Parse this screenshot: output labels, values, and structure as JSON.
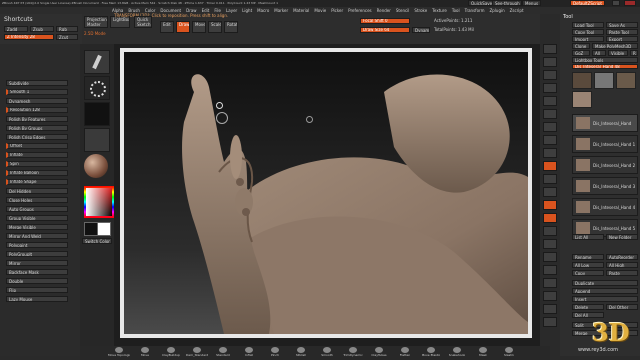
{
  "title_bar": {
    "text": "ZBrush 4R7 P3 (x64)(2-0 Single User License) ZBrush Document · Free Mem 13.8GB · Active Mem 542 · Scratch Disk 48 · ZTime 1.637 · Timer 0.011 · PolyCount 1.43 MP · MeshCount 1",
    "quicksave": "QuickSave",
    "see_through_label": "See-through",
    "see_through_value": "0",
    "menus_label": "Menus",
    "default_zscript": "DefaultZScript"
  },
  "menu_bar": [
    "Alpha",
    "Brush",
    "Color",
    "Document",
    "Draw",
    "Edit",
    "File",
    "Layer",
    "Light",
    "Macro",
    "Marker",
    "Material",
    "Movie",
    "Picker",
    "Preferences",
    "Render",
    "Stencil",
    "Stroke",
    "Texture",
    "Tool",
    "Transform",
    "Zplugin",
    "Zscript"
  ],
  "top_left": {
    "shortcuts_label": "Shortcuts",
    "zadd": "Zadd",
    "zsub": "Zsub",
    "zcut": "Zcut",
    "z_intensity": "Z Intensity 28",
    "rgb": "Rgb"
  },
  "toolbar": {
    "edit_label": "Edit",
    "draw_label": "Draw",
    "move_label": "Move",
    "scale_label": "Scale",
    "rotate_label": "Rotate",
    "focal_shift": "Focal Shift 0",
    "draw_size": "Draw Size 64",
    "active_points": "ActivePoints: 1.211",
    "total_points": "TotalPoints: 1.43 Mil",
    "dynamic": "Dynamic",
    "lightbox": "LightBox",
    "projection_master": "Projection Master",
    "quick_sketch": "Quick Sketch"
  },
  "notice": {
    "title": "2.5D Mode",
    "hint": "TRANSFORM [2D]: Click to reposition. Press shift to align."
  },
  "left_panel": {
    "items": [
      "Subdivide",
      "Smooth 1",
      "Dynamesh",
      "Resolution 128",
      "Polish By Features",
      "Polish By Groups",
      "Polish Crisp Edges",
      "Offset",
      "Inflate",
      "Spin",
      "Inflate Balloon",
      "Inflate Shape",
      "Del Hidden",
      "Close Holes",
      "Auto Groups",
      "Group Visible",
      "Merge Visible",
      "Mirror And Weld",
      "Polypaint",
      "PolyGroupIt",
      "Mirror",
      "Backface Mask",
      "Double",
      "Flip",
      "Lazy Mouse",
      "Switch Color"
    ]
  },
  "right_panel": {
    "header": "Tool",
    "buttons": [
      "Load Tool",
      "Save As",
      "Copy Tool",
      "Paste Tool",
      "Import",
      "Export",
      "Clone",
      "Make PolyMesh3D",
      "GoZ",
      "All",
      "Visible",
      "R",
      "Lightbox Tools"
    ],
    "tool_name": "Dis_Inteseral_Hand 48",
    "subtools": [
      "Dis_Inteseral_Hand",
      "Dis_Inteseral_Hand 1",
      "Dis_Inteseral_Hand 2",
      "Dis_Inteseral_Hand 3",
      "Dis_Inteseral_Hand 4",
      "Dis_Inteseral_Hand 5"
    ],
    "list_all": "List All",
    "new_folder": "New Folder",
    "rename": "Rename",
    "auto_reorder": "AutoReorder",
    "all_low": "All Low",
    "all_high": "All High",
    "copy": "Copy",
    "paste": "Paste",
    "duplicate": "Duplicate",
    "append": "Append",
    "insert": "Insert",
    "delete": "Delete",
    "del_other": "Del Other",
    "del_all": "Del All",
    "split": "Split",
    "merge": "Merge"
  },
  "bottom_brushes": [
    "Move Topological",
    "Move",
    "ClayBuildup",
    "Dam_Standard",
    "Standard",
    "Inflat",
    "Pinch",
    "hPolish",
    "Smooth",
    "TrimDynamic",
    "ClayTubes",
    "Flatten",
    "Move Elastic",
    "Snakehook",
    "Mask",
    "Slash1"
  ],
  "watermark": {
    "logo": "3D",
    "url": "www.rey3d.com"
  },
  "colors": {
    "accent": "#d9531e",
    "viewport_bg": "#1a1a1a",
    "skin": "#9b8473",
    "frame": "#e8e8e8"
  }
}
